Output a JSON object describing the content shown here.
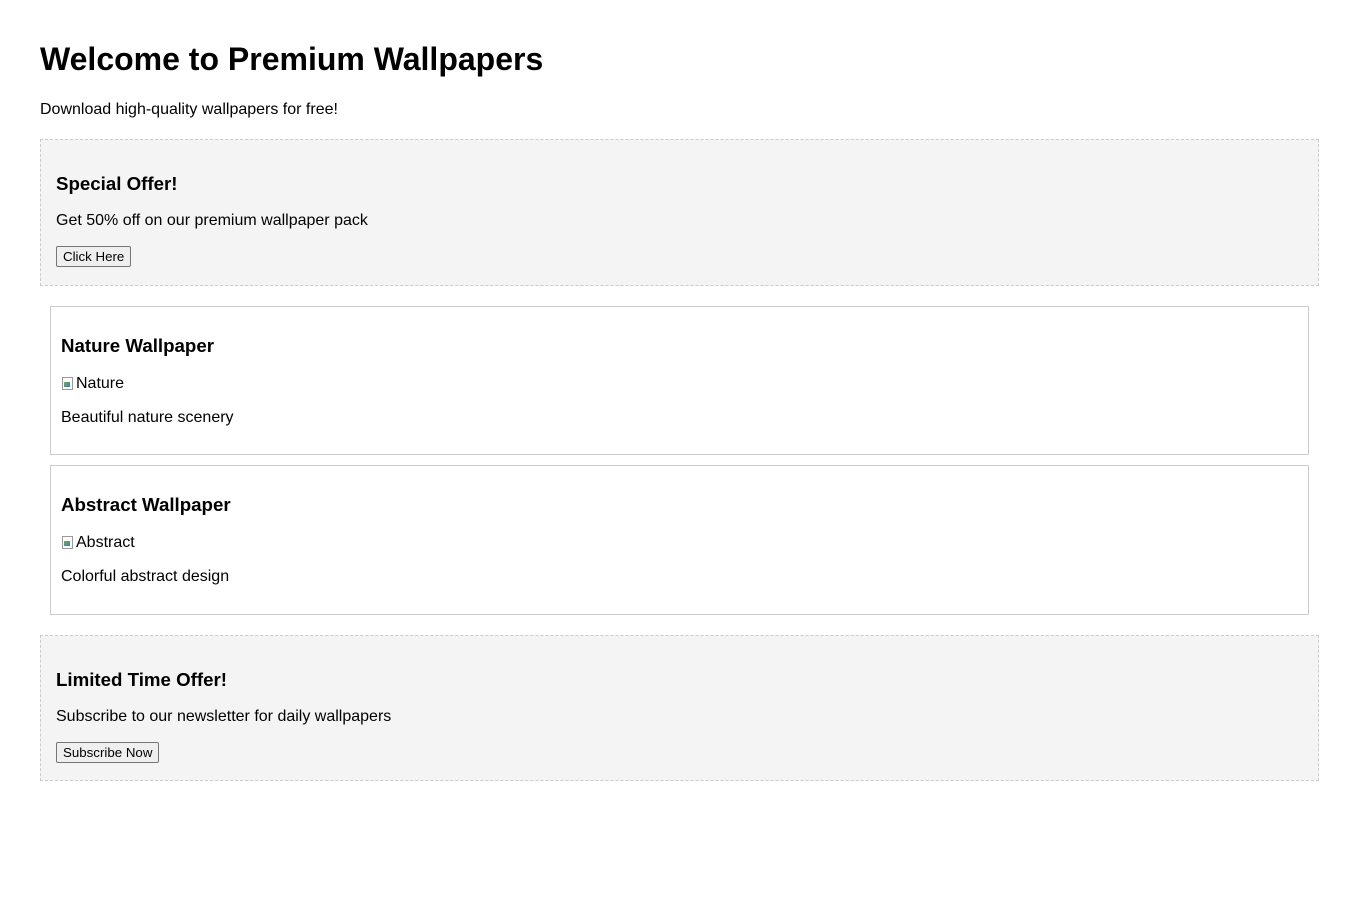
{
  "header": {
    "title": "Welcome to Premium Wallpapers",
    "subtitle": "Download high-quality wallpapers for free!"
  },
  "ads": [
    {
      "title": "Special Offer!",
      "text": "Get 50% off on our premium wallpaper pack",
      "button_label": "Click Here"
    },
    {
      "title": "Limited Time Offer!",
      "text": "Subscribe to our newsletter for daily wallpapers",
      "button_label": "Subscribe Now"
    }
  ],
  "wallpapers": [
    {
      "title": "Nature Wallpaper",
      "image_alt": "Nature",
      "description": "Beautiful nature scenery"
    },
    {
      "title": "Abstract Wallpaper",
      "image_alt": "Abstract",
      "description": "Colorful abstract design"
    }
  ],
  "colors": {
    "ad_background": "#f4f4f4",
    "ad_border": "#cccccc",
    "card_border": "#cccccc",
    "text": "#000000"
  }
}
